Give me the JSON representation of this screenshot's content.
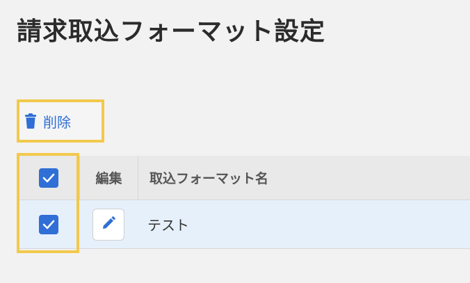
{
  "page": {
    "title": "請求取込フォーマット設定"
  },
  "toolbar": {
    "delete_label": "削除",
    "delete_icon": "trash-icon"
  },
  "table": {
    "columns": [
      "",
      "編集",
      "取込フォーマット名"
    ],
    "select_all_checked": true,
    "rows": [
      {
        "checked": true,
        "edit_icon": "pencil-icon",
        "name": "テスト"
      }
    ]
  },
  "colors": {
    "accent": "#2f6fd6",
    "highlight": "#f2c94c",
    "selected_row": "#e6f0fb"
  }
}
